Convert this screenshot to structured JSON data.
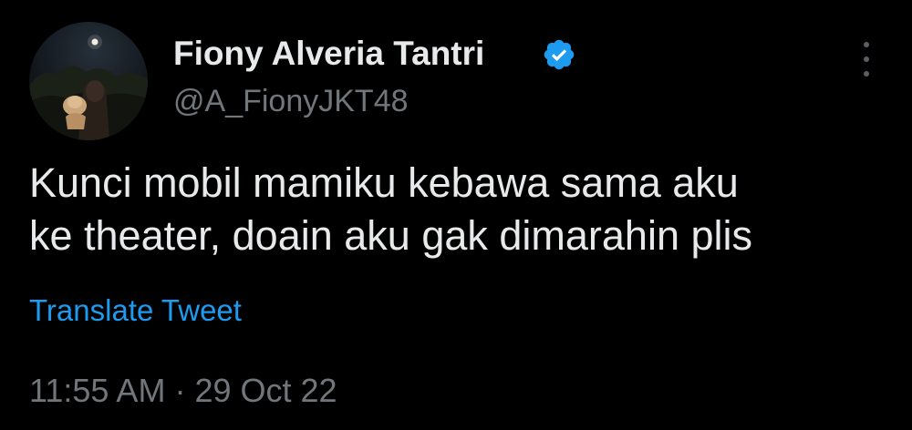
{
  "author": {
    "name": "Fiony Alveria Tantri",
    "handle": "@A_FionyJKT48",
    "verified": true,
    "verified_color": "#1d9bf0"
  },
  "tweet": {
    "text": "Kunci mobil mamiku kebawa sama aku\nke theater, doain aku gak dimarahin plis",
    "translate_label": "Translate Tweet",
    "time": "11:55 AM",
    "separator": "·",
    "date": "29 Oct 22"
  },
  "icons": {
    "more": "more-vertical-icon",
    "verified": "verified-badge-icon"
  },
  "colors": {
    "background": "#000000",
    "primary_text": "#e7e9ea",
    "secondary_text": "#71767b",
    "link": "#1d9bf0"
  }
}
